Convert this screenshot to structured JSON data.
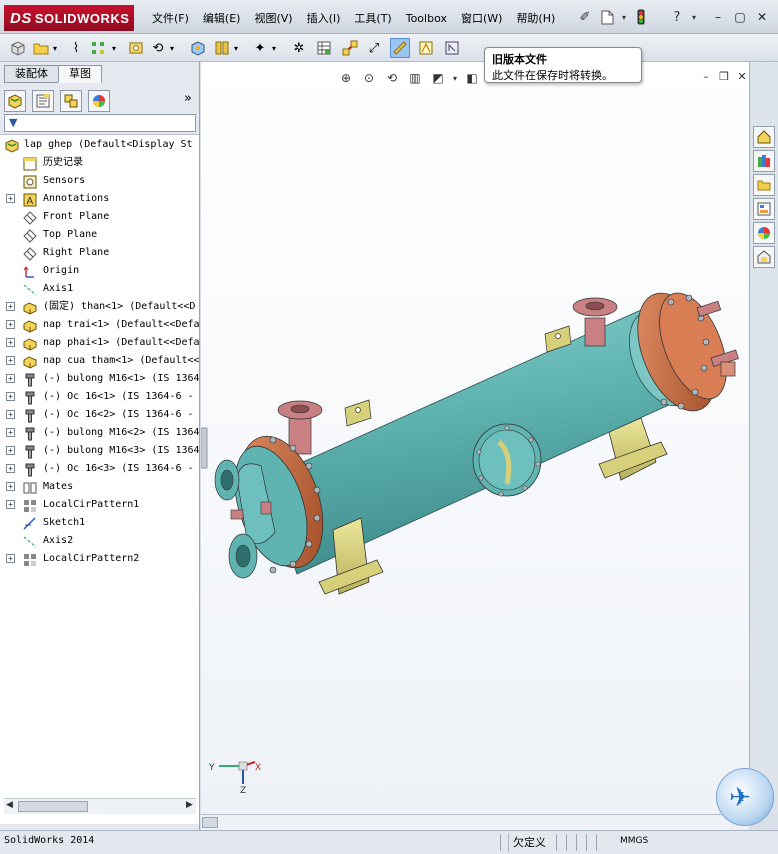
{
  "app": {
    "logo": "SOLIDWORKS",
    "logo_prefix": "DS",
    "menu": [
      "文件(F)",
      "编辑(E)",
      "视图(V)",
      "插入(I)",
      "工具(T)",
      "Toolbox",
      "窗口(W)",
      "帮助(H)"
    ]
  },
  "tooltip": {
    "title": "旧版本文件",
    "body": "此文件在保存时将转换。"
  },
  "left_panel": {
    "tabs": [
      "装配体",
      "草图"
    ],
    "more": "»",
    "filter_icon": "filter-icon"
  },
  "tree": {
    "items": [
      {
        "label": "lap ghep  (Default<Display St",
        "icon": "assembly-icon",
        "expand": "",
        "root": true
      },
      {
        "label": "历史记录",
        "icon": "history-icon",
        "expand": ""
      },
      {
        "label": "Sensors",
        "icon": "sensor-icon",
        "expand": ""
      },
      {
        "label": "Annotations",
        "icon": "annotation-icon",
        "expand": "+"
      },
      {
        "label": "Front Plane",
        "icon": "plane-icon",
        "expand": ""
      },
      {
        "label": "Top Plane",
        "icon": "plane-icon",
        "expand": ""
      },
      {
        "label": "Right Plane",
        "icon": "plane-icon",
        "expand": ""
      },
      {
        "label": "Origin",
        "icon": "origin-icon",
        "expand": ""
      },
      {
        "label": "Axis1",
        "icon": "axis-icon",
        "expand": ""
      },
      {
        "label": "(固定) than<1> (Default<<D",
        "icon": "part-icon",
        "expand": "+"
      },
      {
        "label": "nap trai<1> (Default<<Defa",
        "icon": "part-icon",
        "expand": "+"
      },
      {
        "label": "nap phai<1> (Default<<Defa",
        "icon": "part-icon",
        "expand": "+"
      },
      {
        "label": "nap cua tham<1> (Default<<",
        "icon": "part-icon",
        "expand": "+"
      },
      {
        "label": "(-) bulong M16<1> (IS 1364",
        "icon": "bolt-icon",
        "expand": "+"
      },
      {
        "label": "(-) Oc 16<1> (IS 1364-6 -",
        "icon": "bolt-icon",
        "expand": "+"
      },
      {
        "label": "(-) Oc 16<2> (IS 1364-6 -",
        "icon": "bolt-icon",
        "expand": "+"
      },
      {
        "label": "(-) bulong M16<2> (IS 1364",
        "icon": "bolt-icon",
        "expand": "+"
      },
      {
        "label": "(-) bulong M16<3> (IS 1364",
        "icon": "bolt-icon",
        "expand": "+"
      },
      {
        "label": "(-) Oc 16<3> (IS 1364-6 -",
        "icon": "bolt-icon",
        "expand": "+"
      },
      {
        "label": "Mates",
        "icon": "mates-icon",
        "expand": "+"
      },
      {
        "label": "LocalCirPattern1",
        "icon": "pattern-icon",
        "expand": "+"
      },
      {
        "label": "Sketch1",
        "icon": "sketch-icon",
        "expand": ""
      },
      {
        "label": "Axis2",
        "icon": "axis-icon",
        "expand": ""
      },
      {
        "label": "LocalCirPattern2",
        "icon": "pattern-icon",
        "expand": "+"
      }
    ]
  },
  "triad": {
    "x": "X",
    "y": "Y",
    "z": "Z"
  },
  "status": {
    "app_version": "SolidWorks 2014",
    "definition": "欠定义",
    "units": "MMGS"
  },
  "colors": {
    "shell": "#5fb3b1",
    "flange": "#c8653a",
    "nozzle": "#c98082",
    "support": "#d7d07a"
  }
}
